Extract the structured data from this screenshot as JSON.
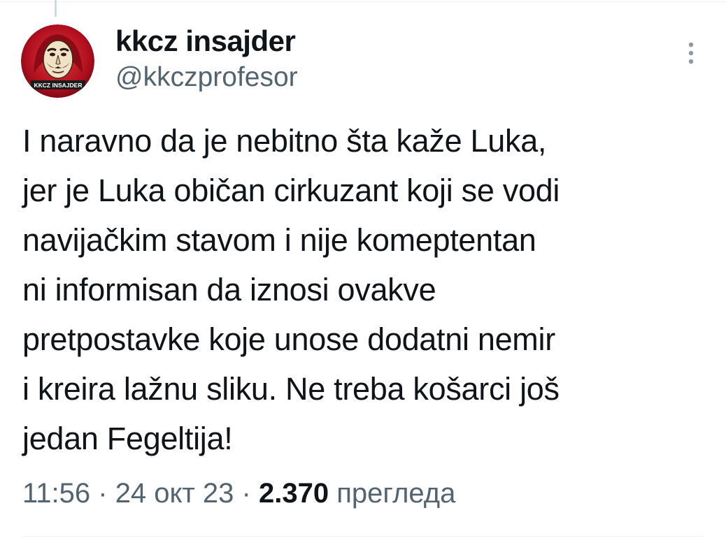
{
  "author": {
    "display_name": "kkcz insajder",
    "handle": "@kkczprofesor",
    "avatar_text": "KKCZ INSAJDER",
    "avatar_icon": "dali-mask-avatar"
  },
  "more_icon": "more-options-icon",
  "tweet": {
    "lines": [
      "I naravno da je nebitno šta kaže Luka,",
      "jer je Luka običan cirkuzant koji se vodi",
      "navijačkim stavom i nije komeptentan",
      "ni informisan da iznosi ovakve",
      "pretpostavke koje unose dodatni nemir",
      "i kreira lažnu sliku. Ne treba košarci još",
      "jedan Fegeltija!"
    ]
  },
  "meta": {
    "time": "11:56",
    "separator": " · ",
    "date": "24 окт 23",
    "views_count": "2.370",
    "views_label": "прегледа"
  },
  "colors": {
    "text_primary": "#0f1419",
    "text_secondary": "#536471",
    "divider": "#eff3f4",
    "avatar_red": "#c8102e"
  }
}
